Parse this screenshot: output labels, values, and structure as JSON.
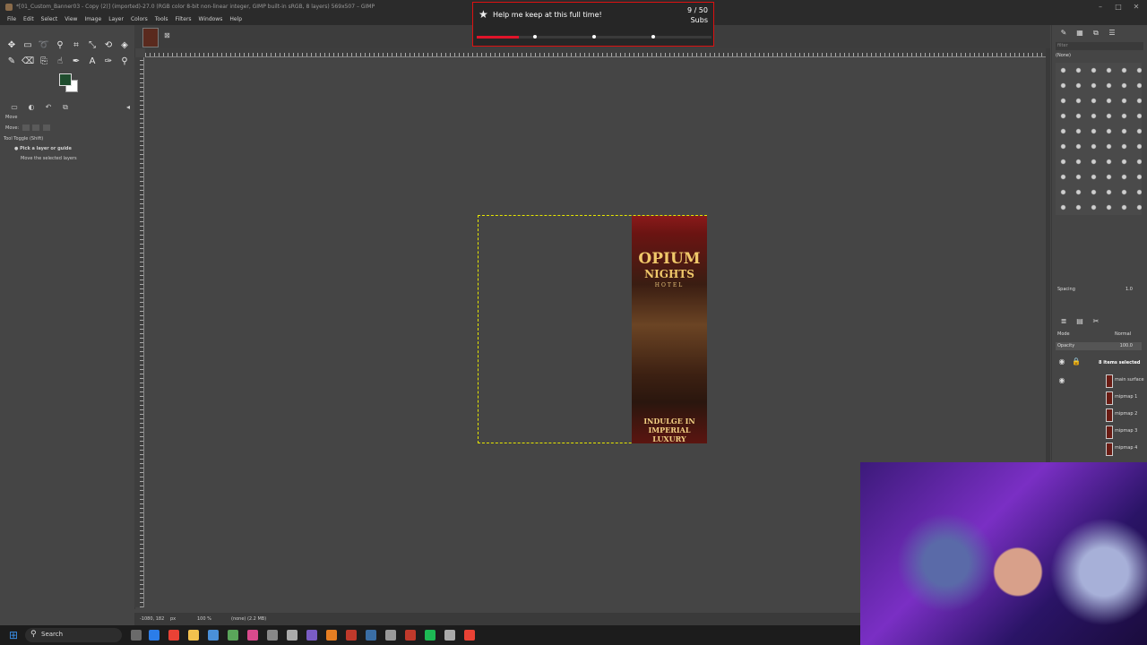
{
  "window": {
    "title": "*[01_Custom_Banner03 - Copy (2)] (imported)-27.0 (RGB color 8-bit non-linear integer, GIMP built-in sRGB, 8 layers) 569x507 – GIMP"
  },
  "menu": [
    "File",
    "Edit",
    "Select",
    "View",
    "Image",
    "Layer",
    "Colors",
    "Tools",
    "Filters",
    "Windows",
    "Help"
  ],
  "tool_options": {
    "tool_name": "Move",
    "move_label": "Move:",
    "toggle_label": "Tool Toggle (Shift)",
    "option_pick": "Pick a layer or guide",
    "option_move": "Move the selected layers"
  },
  "statusbar": {
    "coords": "-1080, 182",
    "unit": "px",
    "zoom": "100 %",
    "info": "(none) (2.2 MB)"
  },
  "banner": {
    "line1": "OPIUM",
    "line2": "NIGHTS",
    "line3": "HOTEL",
    "tagline1": "INDULGE IN",
    "tagline2": "IMPERIAL LUXURY"
  },
  "brushes": {
    "filter_placeholder": "filter",
    "selected": "(None)",
    "spacing_label": "Spacing",
    "spacing_value": "1.0"
  },
  "layers": {
    "mode_label": "Mode",
    "mode_value": "Normal",
    "opacity_label": "Opacity",
    "opacity_value": "100.0",
    "selection_status": "8 items selected",
    "items": [
      "main surface",
      "mipmap 1",
      "mipmap 2",
      "mipmap 3",
      "mipmap 4"
    ]
  },
  "notification": {
    "message": "Help me keep at this full time!",
    "count": "9 / 50",
    "unit": "Subs",
    "progress": 0.18,
    "accent": "#e0142a"
  },
  "taskbar": {
    "search_label": "Search"
  }
}
